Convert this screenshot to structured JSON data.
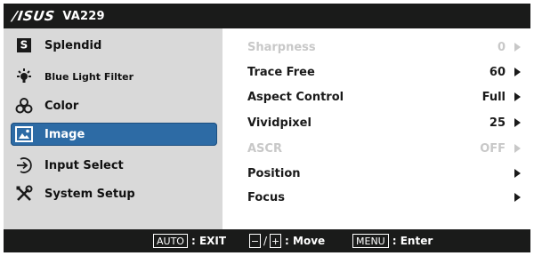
{
  "title_bar": {
    "brand": "/ISUS",
    "model": "VA229"
  },
  "menu": {
    "items": [
      {
        "label": "Splendid",
        "icon": "splendid-s-icon"
      },
      {
        "label": "Blue Light Filter",
        "icon": "bulb-icon"
      },
      {
        "label": "Color",
        "icon": "color-circles-icon"
      },
      {
        "label": "Image",
        "icon": "image-icon",
        "selected": true
      },
      {
        "label": "Input Select",
        "icon": "input-arrow-icon"
      },
      {
        "label": "System Setup",
        "icon": "tools-icon"
      }
    ]
  },
  "settings": {
    "rows": [
      {
        "label": "Sharpness",
        "value": "0",
        "disabled": true
      },
      {
        "label": "Trace Free",
        "value": "60",
        "disabled": false
      },
      {
        "label": "Aspect Control",
        "value": "Full",
        "disabled": false
      },
      {
        "label": "Vividpixel",
        "value": "25",
        "disabled": false
      },
      {
        "label": "ASCR",
        "value": "OFF",
        "disabled": true
      },
      {
        "label": "Position",
        "value": "",
        "disabled": false
      },
      {
        "label": "Focus",
        "value": "",
        "disabled": false
      }
    ]
  },
  "bottom_bar": {
    "auto_key": "AUTO",
    "exit_label": ": EXIT",
    "minus_key": "−",
    "slash": "/",
    "plus_key": "+",
    "move_label": ": Move",
    "menu_key": "MENU",
    "enter_label": ": Enter"
  },
  "colors": {
    "bar_background": "#1a1b1a",
    "menu_background": "#d9d9d9",
    "selected_highlight": "#2d6ba5",
    "disabled_text": "#c8c8c8"
  }
}
